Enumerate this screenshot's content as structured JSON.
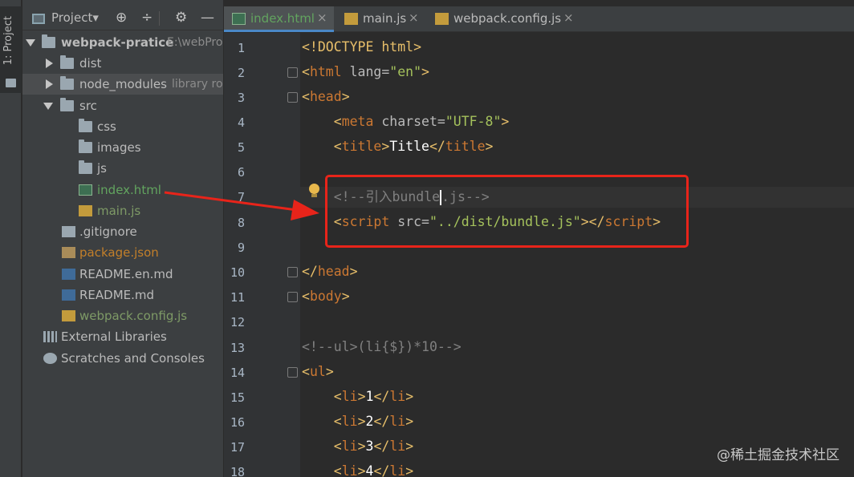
{
  "toolwindow": {
    "side_tab_label": "1: Project"
  },
  "project_panel": {
    "title": "Project",
    "title_arrow": "▾",
    "controls": [
      "⊕",
      "÷",
      "⚙",
      "—"
    ],
    "tree": [
      {
        "label": "webpack-pratice",
        "hint": "E:\\webPro",
        "kind": "folder",
        "expanded": true
      },
      {
        "label": "dist",
        "kind": "folder",
        "expanded": false
      },
      {
        "label": "node_modules",
        "hint": "library ro",
        "kind": "folder",
        "expanded": false
      },
      {
        "label": "src",
        "kind": "folder",
        "expanded": true
      },
      {
        "label": "css",
        "kind": "folder"
      },
      {
        "label": "images",
        "kind": "folder"
      },
      {
        "label": "js",
        "kind": "folder"
      },
      {
        "label": "index.html",
        "kind": "html"
      },
      {
        "label": "main.js",
        "kind": "js"
      },
      {
        "label": ".gitignore",
        "kind": "doc"
      },
      {
        "label": "package.json",
        "kind": "json"
      },
      {
        "label": "README.en.md",
        "kind": "md"
      },
      {
        "label": "README.md",
        "kind": "md"
      },
      {
        "label": "webpack.config.js",
        "kind": "js"
      },
      {
        "label": "External Libraries",
        "kind": "libs"
      },
      {
        "label": "Scratches and Consoles",
        "kind": "scratch"
      }
    ]
  },
  "editor": {
    "tabs": [
      {
        "label": "index.html",
        "close": "×",
        "active": true
      },
      {
        "label": "main.js",
        "close": "×",
        "active": false
      },
      {
        "label": "webpack.config.js",
        "close": "×",
        "active": false
      }
    ],
    "line_numbers": [
      "1",
      "2",
      "3",
      "4",
      "5",
      "6",
      "7",
      "8",
      "9",
      "10",
      "11",
      "12",
      "13",
      "14",
      "15",
      "16",
      "17",
      "18"
    ],
    "code": {
      "l1_open": "<!",
      "l1_tag": "DOCTYPE",
      "l1_attr": " html",
      "l1_close": ">",
      "l2_open": "<",
      "l2_tag": "html",
      "l2_attr": " lang=",
      "l2_val": "\"en\"",
      "l2_close": ">",
      "l3_open": "<",
      "l3_tag": "head",
      "l3_close": ">",
      "l4_indent": "    ",
      "l4_open": "<",
      "l4_tag": "meta",
      "l4_attr": " charset=",
      "l4_val": "\"UTF-8\"",
      "l4_close": ">",
      "l5_indent": "    ",
      "l5_open": "<",
      "l5_tag": "title",
      "l5_mid": ">",
      "l5_text": "Title",
      "l5_end_open": "</",
      "l5_end_tag": "title",
      "l5_close": ">",
      "l7_indent": "    ",
      "l7_comment_a": "<!--引入bundle",
      "l7_comment_b": ".js-->",
      "l8_indent": "    ",
      "l8_open": "<",
      "l8_tag": "script",
      "l8_attr": " src=",
      "l8_val": "\"../dist/bundle.js\"",
      "l8_mid": "></",
      "l8_end_tag": "script",
      "l8_close": ">",
      "l10_open": "</",
      "l10_tag": "head",
      "l10_close": ">",
      "l11_open": "<",
      "l11_tag": "body",
      "l11_close": ">",
      "l13_comment": "<!--ul>(li{$})*10-->",
      "l14_open": "<",
      "l14_tag": "ul",
      "l14_close": ">",
      "li_indent": "    ",
      "li_open": "<",
      "li_tag": "li",
      "li_mid": ">",
      "li_end_open": "</",
      "li_close": ">",
      "li_values": [
        "1",
        "2",
        "3",
        "4"
      ]
    }
  },
  "annotation": {
    "highlight_color": "#e8241a"
  },
  "watermark": "@稀土掘金技术社区"
}
